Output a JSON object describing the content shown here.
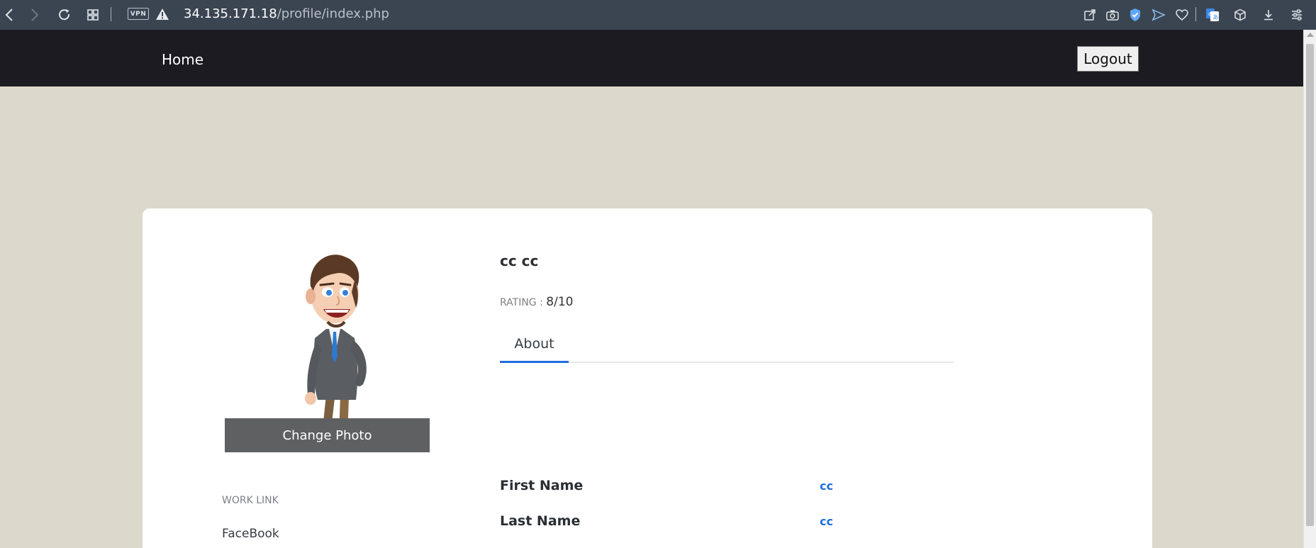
{
  "browser": {
    "url_host": "34.135.171.18",
    "url_path": "/profile/index.php",
    "vpn_label": "VPN"
  },
  "nav": {
    "home_label": "Home",
    "logout_label": "Logout"
  },
  "profile": {
    "name": "cc cc",
    "rating_label": "RATING : ",
    "rating_value": "8/10",
    "change_photo_label": "Change Photo",
    "tabs": [
      {
        "label": "About"
      }
    ],
    "work_link_title": "WORK LINK",
    "work_links": [
      {
        "label": "FaceBook"
      }
    ],
    "fields": [
      {
        "label": "First Name",
        "value": "cc"
      },
      {
        "label": "Last Name",
        "value": "cc"
      }
    ]
  },
  "colors": {
    "page_bg": "#dcd9cc",
    "nav_bg": "#1c1b21",
    "accent": "#1f6ee0",
    "browser_bar": "#3b4552"
  }
}
